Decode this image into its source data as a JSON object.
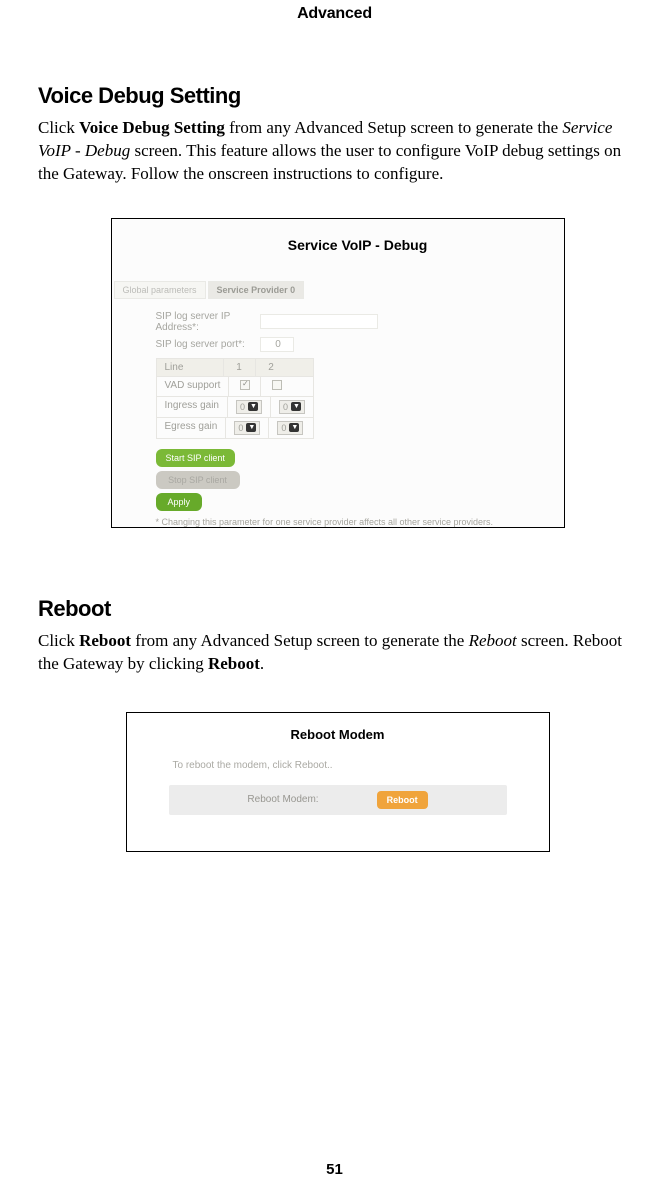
{
  "chapter": "Advanced",
  "page_number": "51",
  "voice_debug": {
    "heading": "Voice Debug Setting",
    "para_prefix": "Click ",
    "para_link": "Voice Debug Setting",
    "para_mid1": " from any Advanced Setup screen to generate the ",
    "para_italic": "Service VoIP - Debug",
    "para_mid2": " screen. This feature allows the user to configure VoIP debug settings on the Gateway. Follow the onscreen instructions to configure.",
    "panel": {
      "title": "Service VoIP - Debug",
      "tab_global": "Global parameters",
      "tab_sp0": "Service Provider 0",
      "lbl_ip": "SIP log server IP Address*:",
      "lbl_port": "SIP log server port*:",
      "port_value": "0",
      "grid": {
        "h_line": "Line",
        "h_c1": "1",
        "h_c2": "2",
        "r_vad": "VAD support",
        "r_ingress": "Ingress gain",
        "r_egress": "Egress gain",
        "zero": "0"
      },
      "btn_start": "Start SIP client",
      "btn_stop": "Stop SIP client",
      "btn_apply": "Apply",
      "note": "* Changing this parameter for one service provider affects all other service providers."
    }
  },
  "reboot": {
    "heading": "Reboot",
    "para_prefix": "Click ",
    "para_link": "Reboot",
    "para_mid1": " from any Advanced Setup screen to generate the ",
    "para_italic": "Reboot",
    "para_mid2": " screen. Reboot the Gateway by clicking ",
    "para_link2": "Reboot",
    "para_end": ".",
    "panel": {
      "title": "Reboot Modem",
      "sub": "To reboot the modem, click Reboot..",
      "bar_label": "Reboot Modem:",
      "btn": "Reboot"
    }
  }
}
